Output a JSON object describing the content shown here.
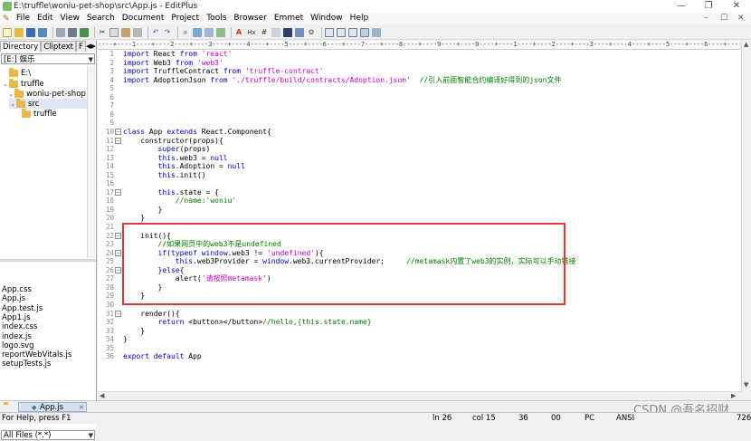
{
  "window": {
    "title": "E:\\truffle\\woniu-pet-shop\\src\\App.js - EditPlus",
    "controls": [
      "—",
      "❐",
      "✕"
    ]
  },
  "menu": {
    "items": [
      "File",
      "Edit",
      "View",
      "Search",
      "Document",
      "Project",
      "Tools",
      "Browser",
      "Emmet",
      "Window",
      "Help"
    ],
    "window_controls": [
      "–",
      "☐",
      "✕"
    ]
  },
  "toolbar": {
    "icons": [
      "new-file-icon",
      "open-file-icon",
      "save-icon",
      "save-all-icon",
      "print-preview-icon",
      "print-icon",
      "spell-check-icon",
      "cut-icon",
      "copy-icon",
      "paste-icon",
      "clipboard-icon",
      "undo-icon",
      "redo-icon",
      "find-icon",
      "find-next-icon",
      "replace-icon",
      "go-to-icon",
      "font-icon",
      "hex-icon",
      "hash-icon",
      "word-wrap-icon",
      "ruler-icon",
      "line-numbers-icon",
      "settings-icon",
      "window-icon",
      "tile-icon",
      "cascade-icon",
      "screen-icon",
      "fullscreen-icon"
    ],
    "hex_label": "Hx"
  },
  "left_panel": {
    "tabs": [
      "Directory",
      "Cliptext",
      "F"
    ],
    "drive": "[E:] 娱乐",
    "tree": [
      {
        "label": "E:\\",
        "indent": 0,
        "chevron": ""
      },
      {
        "label": "truffle",
        "indent": 0,
        "chevron": "⌄"
      },
      {
        "label": "woniu-pet-shop",
        "indent": 1,
        "chevron": "⌄"
      },
      {
        "label": "src",
        "indent": 2,
        "chevron": "⌄",
        "selected": true
      },
      {
        "label": "truffle",
        "indent": 2,
        "chevron": ""
      }
    ],
    "files": [
      "App.css",
      "App.js",
      "App.test.js",
      "App1.js",
      "index.css",
      "index.js",
      "logo.svg",
      "reportWebVitals.js",
      "setupTests.js"
    ],
    "filter": "All Files (*.*)"
  },
  "ruler": "----+----1----+----2----+----3----+----4----+----5----+----6----+----7----+----8----+----9----+----0----+----1----+----2----+----3----+----4----+----5----+----6----+----7",
  "editor": {
    "lines": [
      {
        "n": "1",
        "fold": "",
        "parts": [
          [
            "kw",
            "import"
          ],
          [
            "id",
            " React "
          ],
          [
            "kw",
            "from"
          ],
          [
            "id",
            " "
          ],
          [
            "str",
            "'react'"
          ]
        ]
      },
      {
        "n": "2",
        "fold": "",
        "parts": [
          [
            "kw",
            "import"
          ],
          [
            "id",
            " Web3 "
          ],
          [
            "kw",
            "from"
          ],
          [
            "id",
            " "
          ],
          [
            "str",
            "'web3'"
          ]
        ]
      },
      {
        "n": "3",
        "fold": "",
        "parts": [
          [
            "kw",
            "import"
          ],
          [
            "id",
            " TruffleContract "
          ],
          [
            "kw",
            "from"
          ],
          [
            "id",
            " "
          ],
          [
            "str",
            "'truffle-contract'"
          ]
        ]
      },
      {
        "n": "4",
        "fold": "",
        "parts": [
          [
            "kw",
            "import"
          ],
          [
            "id",
            " AdoptionJson "
          ],
          [
            "kw",
            "from"
          ],
          [
            "id",
            " "
          ],
          [
            "str",
            "'./truffle/build/contracts/Adoption.json'"
          ],
          [
            "id",
            "  "
          ],
          [
            "cm",
            "//引入前面智能合约编译好得到的json文件"
          ]
        ]
      },
      {
        "n": "5",
        "fold": "",
        "parts": []
      },
      {
        "n": "6",
        "fold": "",
        "parts": []
      },
      {
        "n": "7",
        "fold": "",
        "parts": []
      },
      {
        "n": "8",
        "fold": "",
        "parts": []
      },
      {
        "n": "9",
        "fold": "",
        "parts": []
      },
      {
        "n": "10",
        "fold": "−",
        "parts": [
          [
            "kw",
            "class"
          ],
          [
            "id",
            " App "
          ],
          [
            "kw",
            "extends"
          ],
          [
            "id",
            " React.Component{"
          ]
        ]
      },
      {
        "n": "11",
        "fold": "−",
        "parts": [
          [
            "id",
            "    constructor(props){"
          ]
        ]
      },
      {
        "n": "12",
        "fold": "",
        "parts": [
          [
            "id",
            "        "
          ],
          [
            "kw",
            "super"
          ],
          [
            "id",
            "(props)"
          ]
        ]
      },
      {
        "n": "13",
        "fold": "",
        "parts": [
          [
            "id",
            "        "
          ],
          [
            "kw",
            "this"
          ],
          [
            "id",
            ".web3 = "
          ],
          [
            "kw",
            "null"
          ]
        ]
      },
      {
        "n": "14",
        "fold": "",
        "parts": [
          [
            "id",
            "        "
          ],
          [
            "kw",
            "this"
          ],
          [
            "id",
            ".Adoption = "
          ],
          [
            "kw",
            "null"
          ]
        ]
      },
      {
        "n": "15",
        "fold": "",
        "parts": [
          [
            "id",
            "        "
          ],
          [
            "kw",
            "this"
          ],
          [
            "id",
            ".init()"
          ]
        ]
      },
      {
        "n": "16",
        "fold": "",
        "parts": []
      },
      {
        "n": "17",
        "fold": "−",
        "parts": [
          [
            "id",
            "        "
          ],
          [
            "kw",
            "this"
          ],
          [
            "id",
            ".state = {"
          ]
        ]
      },
      {
        "n": "18",
        "fold": "",
        "parts": [
          [
            "id",
            "            "
          ],
          [
            "cm",
            "//name:'woniu'"
          ]
        ]
      },
      {
        "n": "19",
        "fold": "",
        "parts": [
          [
            "id",
            "        }"
          ]
        ]
      },
      {
        "n": "20",
        "fold": "",
        "parts": [
          [
            "id",
            "    }"
          ]
        ]
      },
      {
        "n": "21",
        "fold": "",
        "parts": []
      },
      {
        "n": "22",
        "fold": "−",
        "parts": [
          [
            "id",
            "    init(){"
          ]
        ]
      },
      {
        "n": "23",
        "fold": "",
        "parts": [
          [
            "id",
            "        "
          ],
          [
            "cm",
            "//如果网页中的web3不是undefined"
          ]
        ]
      },
      {
        "n": "24",
        "fold": "−",
        "parts": [
          [
            "id",
            "        "
          ],
          [
            "kw",
            "if"
          ],
          [
            "id",
            "("
          ],
          [
            "kw",
            "typeof"
          ],
          [
            "id",
            " "
          ],
          [
            "kw",
            "window"
          ],
          [
            "id",
            ".web3 != "
          ],
          [
            "str",
            "'undefined'"
          ],
          [
            "id",
            "){"
          ]
        ]
      },
      {
        "n": "25",
        "fold": "",
        "parts": [
          [
            "id",
            "            "
          ],
          [
            "kw",
            "this"
          ],
          [
            "id",
            ".web3Provider = "
          ],
          [
            "kw",
            "window"
          ],
          [
            "id",
            ".web3.currentProvider;     "
          ],
          [
            "cm",
            "//metamask内置了web3的实例，实际可以手动链接"
          ]
        ]
      },
      {
        "n": "26",
        "fold": "−",
        "parts": [
          [
            "id",
            "        }"
          ],
          [
            "kw",
            "else"
          ],
          [
            "id",
            "{"
          ]
        ]
      },
      {
        "n": "27",
        "fold": "",
        "parts": [
          [
            "id",
            "            alert("
          ],
          [
            "str",
            "'请按照metamask'"
          ],
          [
            "id",
            ")"
          ]
        ]
      },
      {
        "n": "28",
        "fold": "",
        "parts": [
          [
            "id",
            "        }"
          ]
        ]
      },
      {
        "n": "29",
        "fold": "",
        "parts": [
          [
            "id",
            "    }"
          ]
        ]
      },
      {
        "n": "30",
        "fold": "",
        "parts": []
      },
      {
        "n": "31",
        "fold": "−",
        "parts": [
          [
            "id",
            "    render(){"
          ]
        ]
      },
      {
        "n": "32",
        "fold": "",
        "parts": [
          [
            "id",
            "        "
          ],
          [
            "kw",
            "return"
          ],
          [
            "id",
            " <button></button>"
          ],
          [
            "cm",
            "//hello,{this.state.name}"
          ]
        ]
      },
      {
        "n": "33",
        "fold": "",
        "parts": [
          [
            "id",
            "    }"
          ]
        ]
      },
      {
        "n": "34",
        "fold": "",
        "parts": [
          [
            "id",
            "}"
          ]
        ]
      },
      {
        "n": "35",
        "fold": "",
        "parts": []
      },
      {
        "n": "36",
        "fold": "",
        "parts": [
          [
            "kw",
            "export"
          ],
          [
            "id",
            " "
          ],
          [
            "kw",
            "default"
          ],
          [
            "id",
            " App"
          ]
        ]
      }
    ]
  },
  "doc_tab": {
    "label": "App.js",
    "close": "✕"
  },
  "status": {
    "help": "For Help, press F1",
    "line": "ln 26",
    "col": "col 15",
    "a": "36",
    "b": "00",
    "mode": "PC",
    "encoding": "ANSI",
    "size": "726"
  },
  "watermark": "CSDN @吾名招财"
}
